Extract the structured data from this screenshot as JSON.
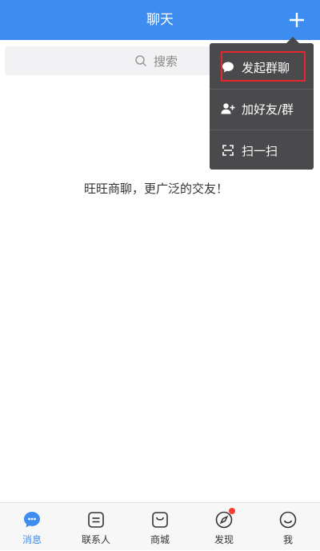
{
  "header": {
    "title": "聊天",
    "plus_icon": "plus-icon"
  },
  "search": {
    "placeholder": "搜索",
    "icon": "search-icon"
  },
  "empty_state": {
    "message": "旺旺商聊，更广泛的交友！"
  },
  "dropdown": {
    "items": [
      {
        "label": "发起群聊",
        "icon": "chat-bubble-icon",
        "highlighted": true
      },
      {
        "label": "加好友/群",
        "icon": "add-user-icon",
        "highlighted": false
      },
      {
        "label": "扫一扫",
        "icon": "scan-icon",
        "highlighted": false
      }
    ]
  },
  "tabbar": {
    "items": [
      {
        "label": "消息",
        "icon": "message-icon",
        "active": true
      },
      {
        "label": "联系人",
        "icon": "contacts-icon",
        "active": false
      },
      {
        "label": "商城",
        "icon": "shop-icon",
        "active": false
      },
      {
        "label": "发现",
        "icon": "compass-icon",
        "active": false,
        "badge": true
      },
      {
        "label": "我",
        "icon": "smile-icon",
        "active": false
      }
    ]
  },
  "colors": {
    "header": "#3d8cf0",
    "active_tab": "#3d8cf0",
    "menu_bg": "#4a4a4c",
    "highlight": "#e8262e",
    "badge": "#ff3b30"
  }
}
